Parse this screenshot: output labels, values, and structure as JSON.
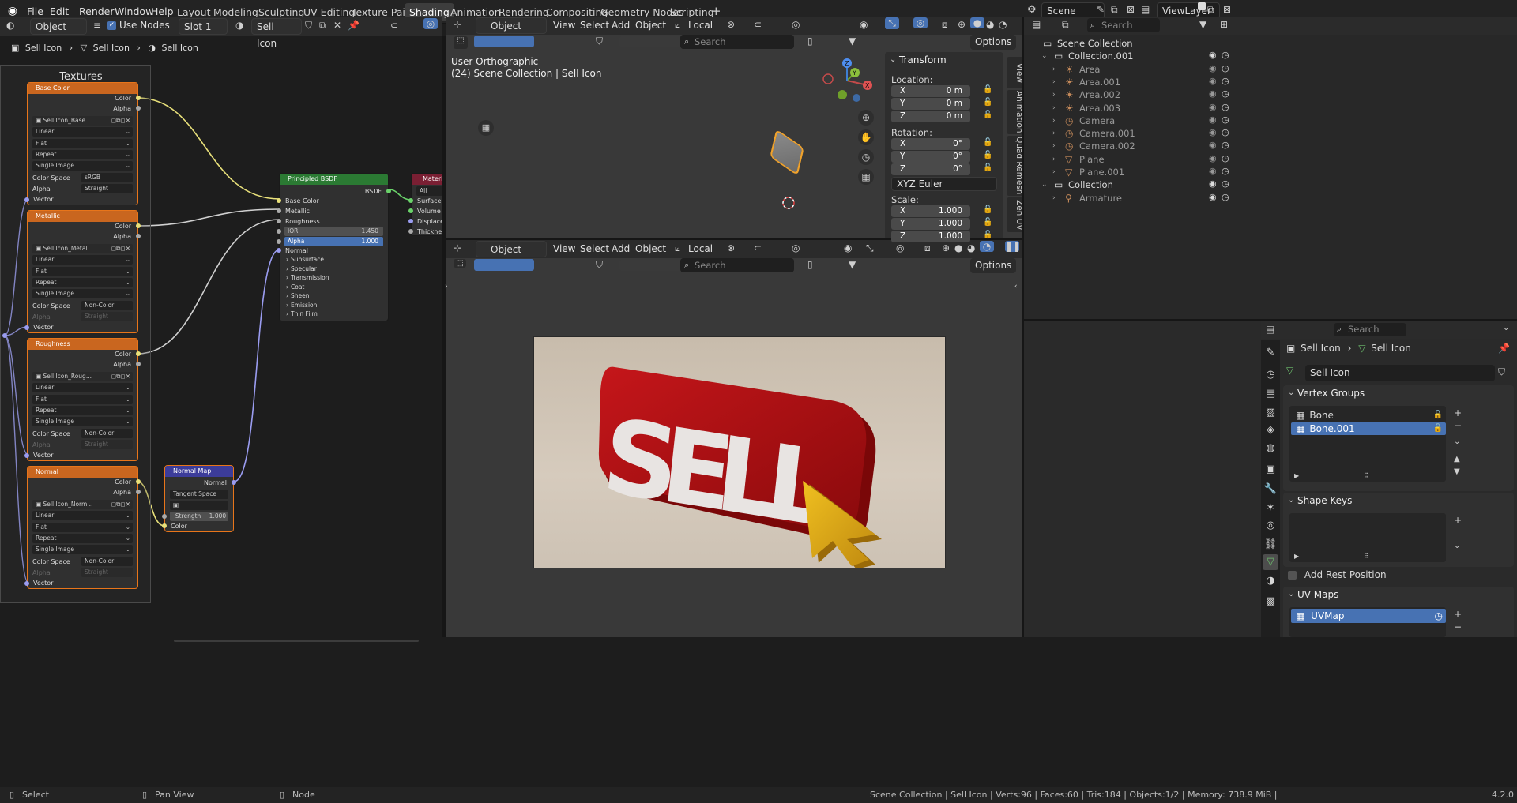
{
  "menu": {
    "items": [
      "File",
      "Edit",
      "Render",
      "Window",
      "Help"
    ]
  },
  "workspaces": [
    "Layout",
    "Modeling",
    "Sculpting",
    "UV Editing",
    "Texture Paint",
    "Shading",
    "Animation",
    "Rendering",
    "Compositing",
    "Geometry Nodes",
    "Scripting"
  ],
  "active_workspace": "Shading",
  "scene": {
    "name": "Scene",
    "view_layer": "ViewLayer"
  },
  "node_editor": {
    "object_type": "Object",
    "use_nodes": "Use Nodes",
    "slot": "Slot 1",
    "material": "Sell Icon",
    "breadcrumb": [
      "Sell Icon",
      "Sell Icon",
      "Sell Icon"
    ],
    "frame_title": "Textures",
    "texture_nodes": [
      {
        "title": "Base Color",
        "image": "Sell Icon_Base...",
        "interp": "Linear",
        "proj": "Flat",
        "ext": "Repeat",
        "source": "Single Image",
        "colorspace": "sRGB",
        "alpha": "Straight",
        "alpha_enabled": true
      },
      {
        "title": "Metallic",
        "image": "Sell Icon_Metall...",
        "interp": "Linear",
        "proj": "Flat",
        "ext": "Repeat",
        "source": "Single Image",
        "colorspace": "Non-Color",
        "alpha": "Straight",
        "alpha_enabled": false
      },
      {
        "title": "Roughness",
        "image": "Sell Icon_Roug...",
        "interp": "Linear",
        "proj": "Flat",
        "ext": "Repeat",
        "source": "Single Image",
        "colorspace": "Non-Color",
        "alpha": "Straight",
        "alpha_enabled": false
      },
      {
        "title": "Normal",
        "image": "Sell Icon_Norm...",
        "interp": "Linear",
        "proj": "Flat",
        "ext": "Repeat",
        "source": "Single Image",
        "colorspace": "Non-Color",
        "alpha": "Straight",
        "alpha_enabled": false
      }
    ],
    "tex_labels": {
      "color": "Color",
      "alpha": "Alpha",
      "vector": "Vector",
      "colorspace": "Color Space",
      "alpha_label": "Alpha"
    },
    "bsdf": {
      "title": "Principled BSDF",
      "out": "BSDF",
      "inputs": [
        "Base Color",
        "Metallic",
        "Roughness"
      ],
      "ior_label": "IOR",
      "ior": "1.450",
      "alpha_label": "Alpha",
      "alpha": "1.000",
      "normal": "Normal",
      "panels": [
        "Subsurface",
        "Specular",
        "Transmission",
        "Coat",
        "Sheen",
        "Emission",
        "Thin Film"
      ]
    },
    "material_output": {
      "title": "Material",
      "target": "All",
      "inputs": [
        "Surface",
        "Volume",
        "Displacem",
        "Thickness"
      ]
    },
    "normal_map": {
      "title": "Normal Map",
      "out": "Normal",
      "space": "Tangent Space",
      "strength_label": "Strength",
      "strength": "1.000",
      "color": "Color"
    }
  },
  "viewport_top": {
    "mode": "Object Mode",
    "menus": [
      "View",
      "Select",
      "Add",
      "Object"
    ],
    "orientation": "Local",
    "search_placeholder": "Search",
    "options": "Options",
    "view_name": "User Orthographic",
    "collection_info": "(24) Scene Collection | Sell Icon",
    "transform": {
      "title": "Transform",
      "location": "Location:",
      "rotation": "Rotation:",
      "scale": "Scale:",
      "loc": [
        "0 m",
        "0 m",
        "0 m"
      ],
      "rot": [
        "0°",
        "0°",
        "0°"
      ],
      "rot_mode": "XYZ Euler",
      "scl": [
        "1.000",
        "1.000",
        "1.000"
      ],
      "axes": [
        "X",
        "Y",
        "Z"
      ]
    },
    "side_tabs": [
      "View",
      "Animation",
      "Quad Remesh",
      "Zen UV"
    ],
    "gizmo": [
      "X",
      "Y",
      "Z"
    ]
  },
  "viewport_bottom": {
    "mode": "Object Mode",
    "menus": [
      "View",
      "Select",
      "Add",
      "Object"
    ],
    "orientation": "Local",
    "search_placeholder": "Search",
    "options": "Options",
    "render_text": "SELL"
  },
  "outliner": {
    "search_placeholder": "Search",
    "items": [
      {
        "label": "Scene Collection",
        "depth": 0,
        "kind": "collection"
      },
      {
        "label": "Collection.001",
        "depth": 1,
        "kind": "collection"
      },
      {
        "label": "Area",
        "depth": 2,
        "kind": "light"
      },
      {
        "label": "Area.001",
        "depth": 2,
        "kind": "light"
      },
      {
        "label": "Area.002",
        "depth": 2,
        "kind": "light"
      },
      {
        "label": "Area.003",
        "depth": 2,
        "kind": "light"
      },
      {
        "label": "Camera",
        "depth": 2,
        "kind": "camera"
      },
      {
        "label": "Camera.001",
        "depth": 2,
        "kind": "camera"
      },
      {
        "label": "Camera.002",
        "depth": 2,
        "kind": "camera"
      },
      {
        "label": "Plane",
        "depth": 2,
        "kind": "mesh"
      },
      {
        "label": "Plane.001",
        "depth": 2,
        "kind": "mesh"
      },
      {
        "label": "Collection",
        "depth": 1,
        "kind": "collection"
      },
      {
        "label": "Armature",
        "depth": 2,
        "kind": "armature"
      }
    ]
  },
  "properties": {
    "search_placeholder": "Search",
    "breadcrumb": [
      "Sell Icon",
      "Sell Icon"
    ],
    "mesh_name": "Sell Icon",
    "vertex_groups": {
      "title": "Vertex Groups",
      "items": [
        "Bone",
        "Bone.001"
      ],
      "selected": "Bone.001"
    },
    "shape_keys": {
      "title": "Shape Keys"
    },
    "add_rest_position": "Add Rest Position",
    "uv_maps": {
      "title": "UV Maps",
      "items": [
        "UVMap"
      ]
    }
  },
  "statusbar": {
    "select": "Select",
    "pan": "Pan View",
    "node": "Node",
    "info": "Scene Collection | Sell Icon | Verts:96 | Faces:60 | Tris:184 | Objects:1/2 | Memory: 738.9 MiB | ",
    "version": "4.2.0"
  },
  "colors": {
    "accent": "#4772b3",
    "texture_header": "#c9661f",
    "bsdf_header": "#2b7a33",
    "normalmap_header": "#3c3c9a",
    "material_header": "#7a1f33",
    "active_object": "#f0a22c"
  }
}
